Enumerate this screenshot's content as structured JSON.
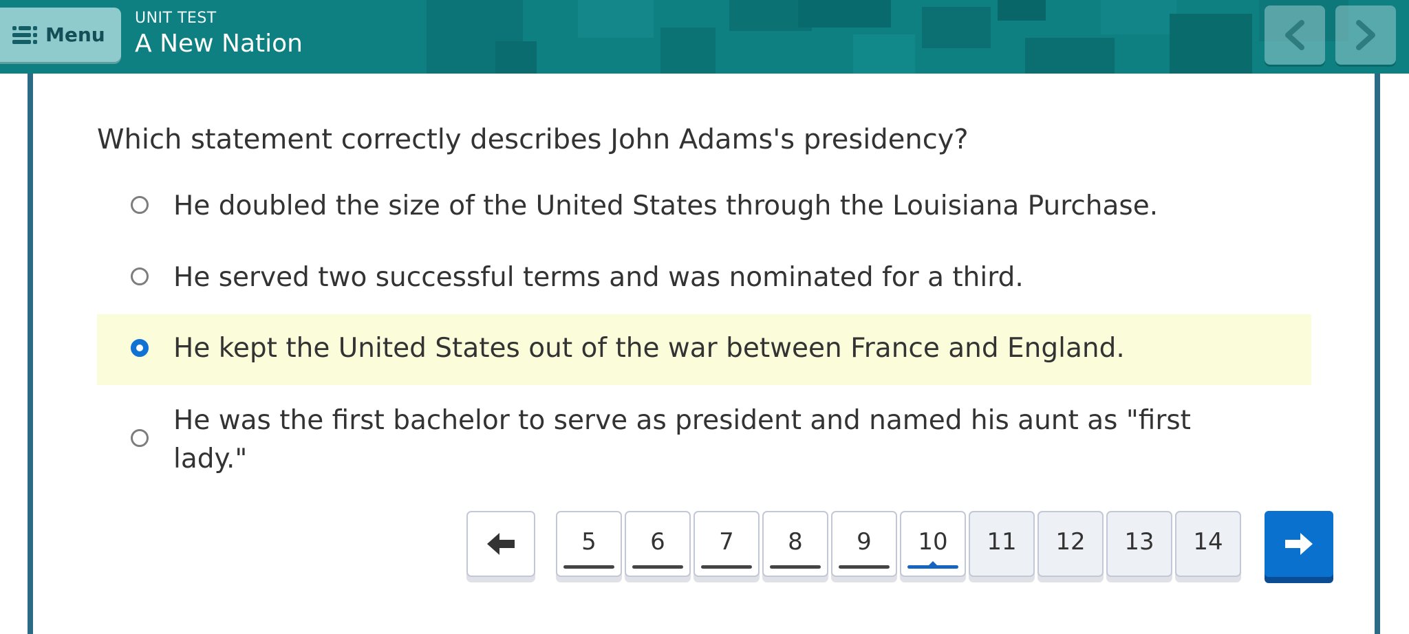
{
  "header": {
    "menu_label": "Menu",
    "kicker": "UNIT TEST",
    "title": "A New Nation",
    "prev_icon": "chevron-left-icon",
    "next_icon": "chevron-right-icon"
  },
  "question": {
    "text": "Which statement correctly describes John Adams's presidency?",
    "options": [
      {
        "text": "He doubled the size of the United States through the Louisiana Purchase.",
        "selected": false
      },
      {
        "text": "He served two successful terms and was nominated for a third.",
        "selected": false
      },
      {
        "text": "He kept the United States out of the war between France and England.",
        "selected": true
      },
      {
        "text": "He was the first bachelor to serve as president and named his aunt as \"first lady.\"",
        "selected": false
      }
    ]
  },
  "pager": {
    "pages": [
      "5",
      "6",
      "7",
      "8",
      "9",
      "10",
      "11",
      "12",
      "13",
      "14"
    ],
    "current": "10",
    "prev_icon": "arrow-left-icon",
    "next_icon": "arrow-right-icon"
  },
  "colors": {
    "header_bg": "#0e8082",
    "selected_bg": "#fbfcd9",
    "accent_blue": "#0b71cf",
    "frame": "#2b6b85"
  }
}
